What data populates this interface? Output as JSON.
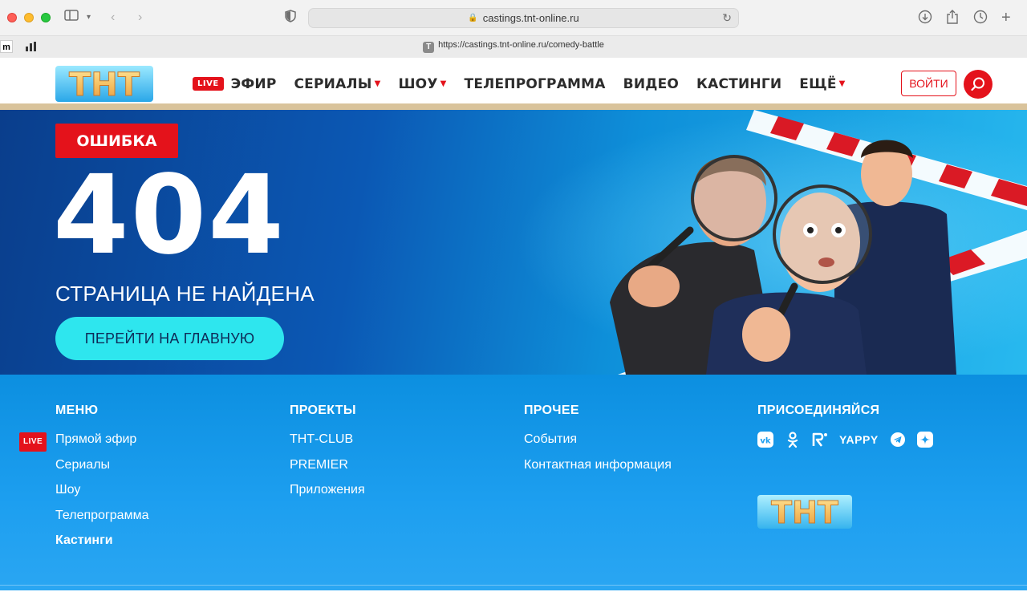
{
  "browser": {
    "address_text": "castings.tnt-online.ru",
    "tab_url": "https://castings.tnt-online.ru/comedy-battle",
    "tab_favicon_letter": "T",
    "pinned_1": "m"
  },
  "header": {
    "logo_text": "ТНТ",
    "nav": [
      {
        "label": "ЭФИР",
        "live": "LIVE"
      },
      {
        "label": "СЕРИАЛЫ"
      },
      {
        "label": "ШОУ"
      },
      {
        "label": "ТЕЛЕПРОГРАММА"
      },
      {
        "label": "ВИДЕО"
      },
      {
        "label": "КАСТИНГИ"
      },
      {
        "label": "ЕЩЁ"
      }
    ],
    "login_label": "ВОЙТИ"
  },
  "hero": {
    "badge": "ОШИБКА",
    "code": "404",
    "message": "СТРАНИЦА НЕ НАЙДЕНА",
    "home_button": "ПЕРЕЙТИ НА ГЛАВНУЮ"
  },
  "footer": {
    "menu": {
      "title": "МЕНЮ",
      "live_badge": "LIVE",
      "links": [
        "Прямой эфир",
        "Сериалы",
        "Шоу",
        "Телепрограмма",
        "Кастинги"
      ]
    },
    "projects": {
      "title": "ПРОЕКТЫ",
      "links": [
        "ТНТ-CLUB",
        "PREMIER",
        "Приложения"
      ]
    },
    "other": {
      "title": "ПРОЧЕЕ",
      "links": [
        "События",
        "Контактная информация"
      ]
    },
    "join": {
      "title": "ПРИСОЕДИНЯЙСЯ",
      "yappy": "YAPPY",
      "icons": [
        "vk-icon",
        "odnoklassniki-icon",
        "rutube-icon",
        "yappy-icon",
        "telegram-icon",
        "dzen-icon"
      ]
    },
    "logo_text": "ТНТ"
  },
  "colors": {
    "brand_red": "#e4121b",
    "hero_blue": "#0b58b4",
    "button_cyan": "#2ee6ee",
    "footer_blue": "#1d9ff0"
  }
}
